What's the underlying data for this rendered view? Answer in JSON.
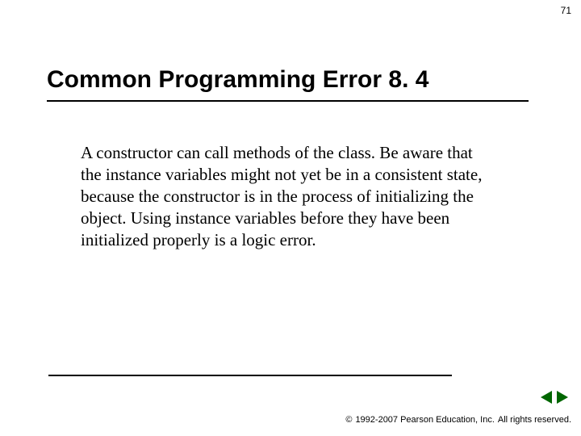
{
  "page_number": "71",
  "title": "Common Programming Error 8. 4",
  "body": "A constructor can call methods of the class. Be aware that the instance variables might not yet be in a consistent state, because the constructor is in the process of initializing the object. Using instance variables before they have been initialized properly is a logic error.",
  "copyright_symbol": "©",
  "copyright_years": "1992-2007 Pearson Education, Inc.",
  "copyright_rights": "All rights reserved.",
  "nav": {
    "prev": "previous-slide",
    "next": "next-slide"
  },
  "colors": {
    "accent": "#006600"
  }
}
